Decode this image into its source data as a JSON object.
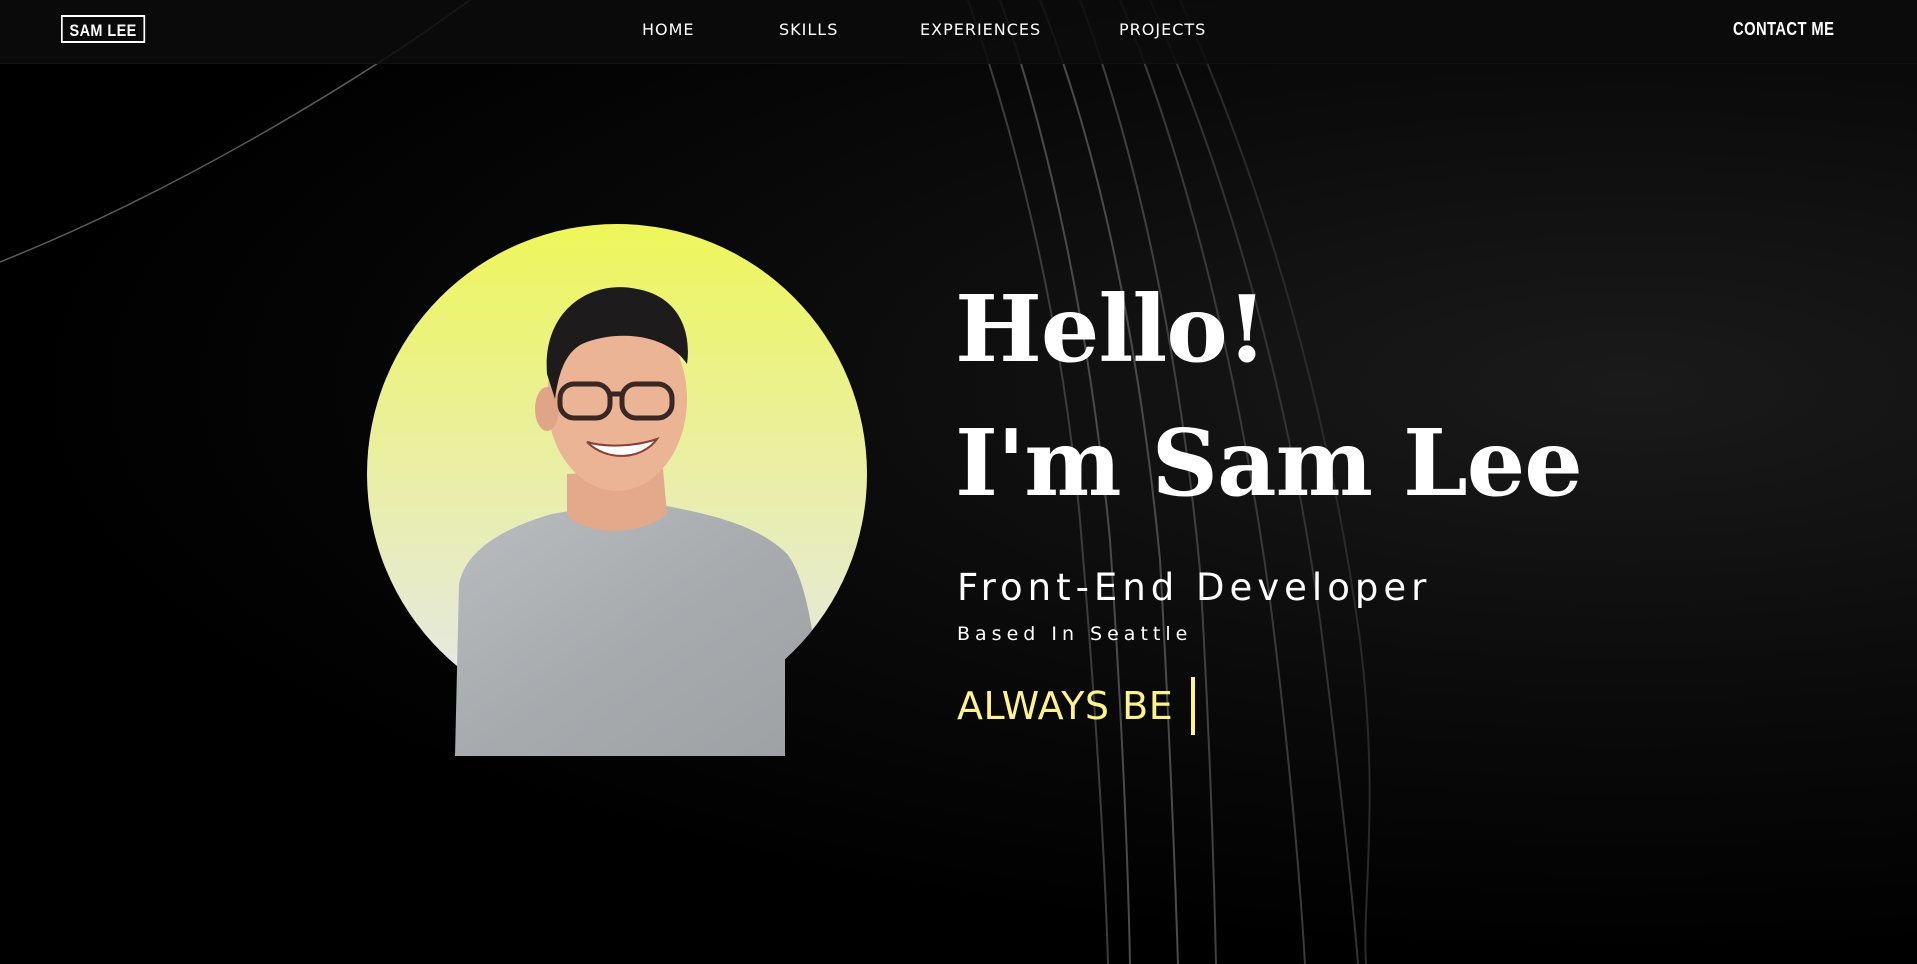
{
  "header": {
    "logo": "SAM LEE",
    "nav": [
      {
        "label": "HOME"
      },
      {
        "label": "SKILLS"
      },
      {
        "label": "EXPERIENCES"
      },
      {
        "label": "PROJECTS"
      }
    ],
    "contact_label": "CONTACT ME"
  },
  "hero": {
    "greeting": "Hello!",
    "intro": "I'm Sam Lee",
    "role": "Front-End Developer",
    "location": "Based In Seattle",
    "typed_text": "ALWAYS BE"
  },
  "colors": {
    "background": "#000000",
    "text": "#ffffff",
    "accent": "#fdf38a",
    "portrait_gradient_top": "#eef65a",
    "portrait_gradient_bottom": "#e4e7ef"
  },
  "icons": {
    "cursor": "text-cursor"
  }
}
